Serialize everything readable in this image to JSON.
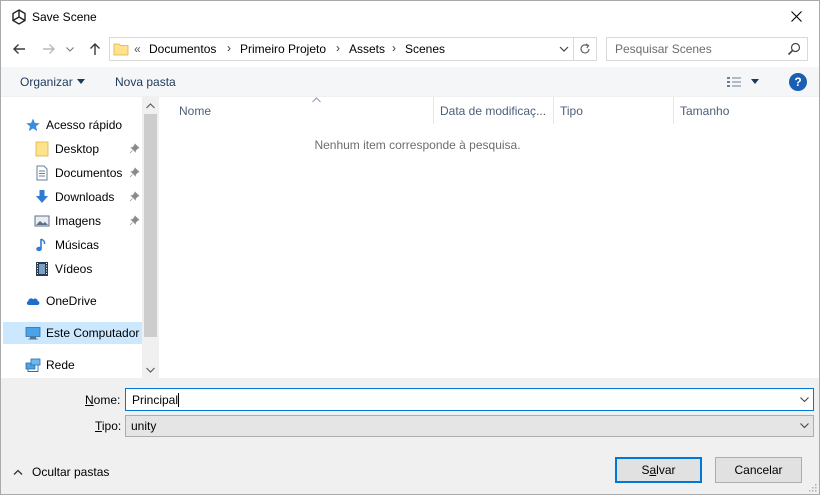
{
  "window": {
    "title": "Save Scene"
  },
  "address": {
    "overflow_glyph": "«",
    "crumbs": [
      "Documentos",
      "Primeiro Projeto",
      "Assets",
      "Scenes"
    ],
    "search_placeholder": "Pesquisar Scenes"
  },
  "toolbar": {
    "organize_label": "Organizar",
    "new_folder_label": "Nova pasta",
    "help_label": "?"
  },
  "nav": {
    "items": [
      {
        "label": "Acesso rápido",
        "icon": "star-icon"
      },
      {
        "label": "Desktop",
        "icon": "folder-icon",
        "pinned": true
      },
      {
        "label": "Documentos",
        "icon": "document-icon",
        "pinned": true
      },
      {
        "label": "Downloads",
        "icon": "download-icon",
        "pinned": true
      },
      {
        "label": "Imagens",
        "icon": "picture-icon",
        "pinned": true
      },
      {
        "label": "Músicas",
        "icon": "music-icon"
      },
      {
        "label": "Vídeos",
        "icon": "video-icon"
      },
      {
        "label": "OneDrive",
        "icon": "cloud-icon"
      },
      {
        "label": "Este Computador",
        "icon": "computer-icon",
        "selected": true
      },
      {
        "label": "Rede",
        "icon": "network-icon"
      }
    ]
  },
  "filelist": {
    "columns": [
      "Nome",
      "Data de modificaç...",
      "Tipo",
      "Tamanho"
    ],
    "empty_message": "Nenhum item corresponde à pesquisa."
  },
  "form": {
    "name_label": "Nome:",
    "name_value": "Principal",
    "type_label": "Tipo:",
    "type_value": "unity"
  },
  "footer": {
    "hide_folders_label": "Ocultar pastas",
    "save_label": "Salvar",
    "cancel_label": "Cancelar"
  },
  "colors": {
    "accent": "#0078d7",
    "selected_bg": "#cce8ff",
    "link_text": "#1e395b"
  }
}
